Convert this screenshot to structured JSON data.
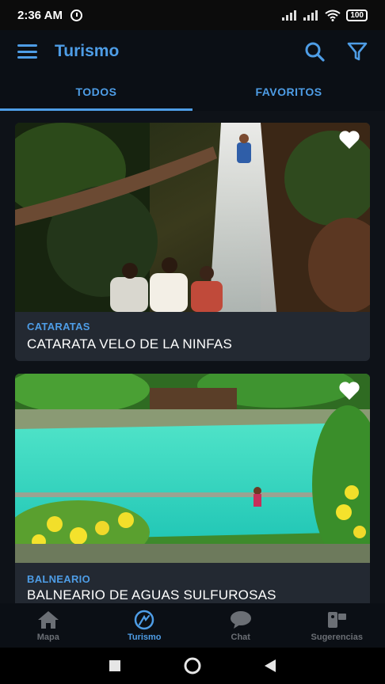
{
  "status_bar": {
    "time": "2:36 AM",
    "battery": "100"
  },
  "app_bar": {
    "title": "Turismo"
  },
  "tabs": [
    {
      "label": "TODOS",
      "active": true
    },
    {
      "label": "FAVORITOS",
      "active": false
    }
  ],
  "cards": [
    {
      "category": "CATARATAS",
      "title": "CATARATA VELO DE LA NINFAS"
    },
    {
      "category": "BALNEARIO",
      "title": "BALNEARIO DE AGUAS SULFUROSAS"
    }
  ],
  "bottom_nav": [
    {
      "label": "Mapa",
      "icon": "home-icon",
      "active": false
    },
    {
      "label": "Turismo",
      "icon": "tourism-icon",
      "active": true
    },
    {
      "label": "Chat",
      "icon": "chat-icon",
      "active": false
    },
    {
      "label": "Sugerencias",
      "icon": "suggestion-icon",
      "active": false
    }
  ],
  "colors": {
    "accent": "#4e9de6",
    "background": "#0e1218",
    "card": "#232932",
    "inactive": "#6b6f75"
  }
}
